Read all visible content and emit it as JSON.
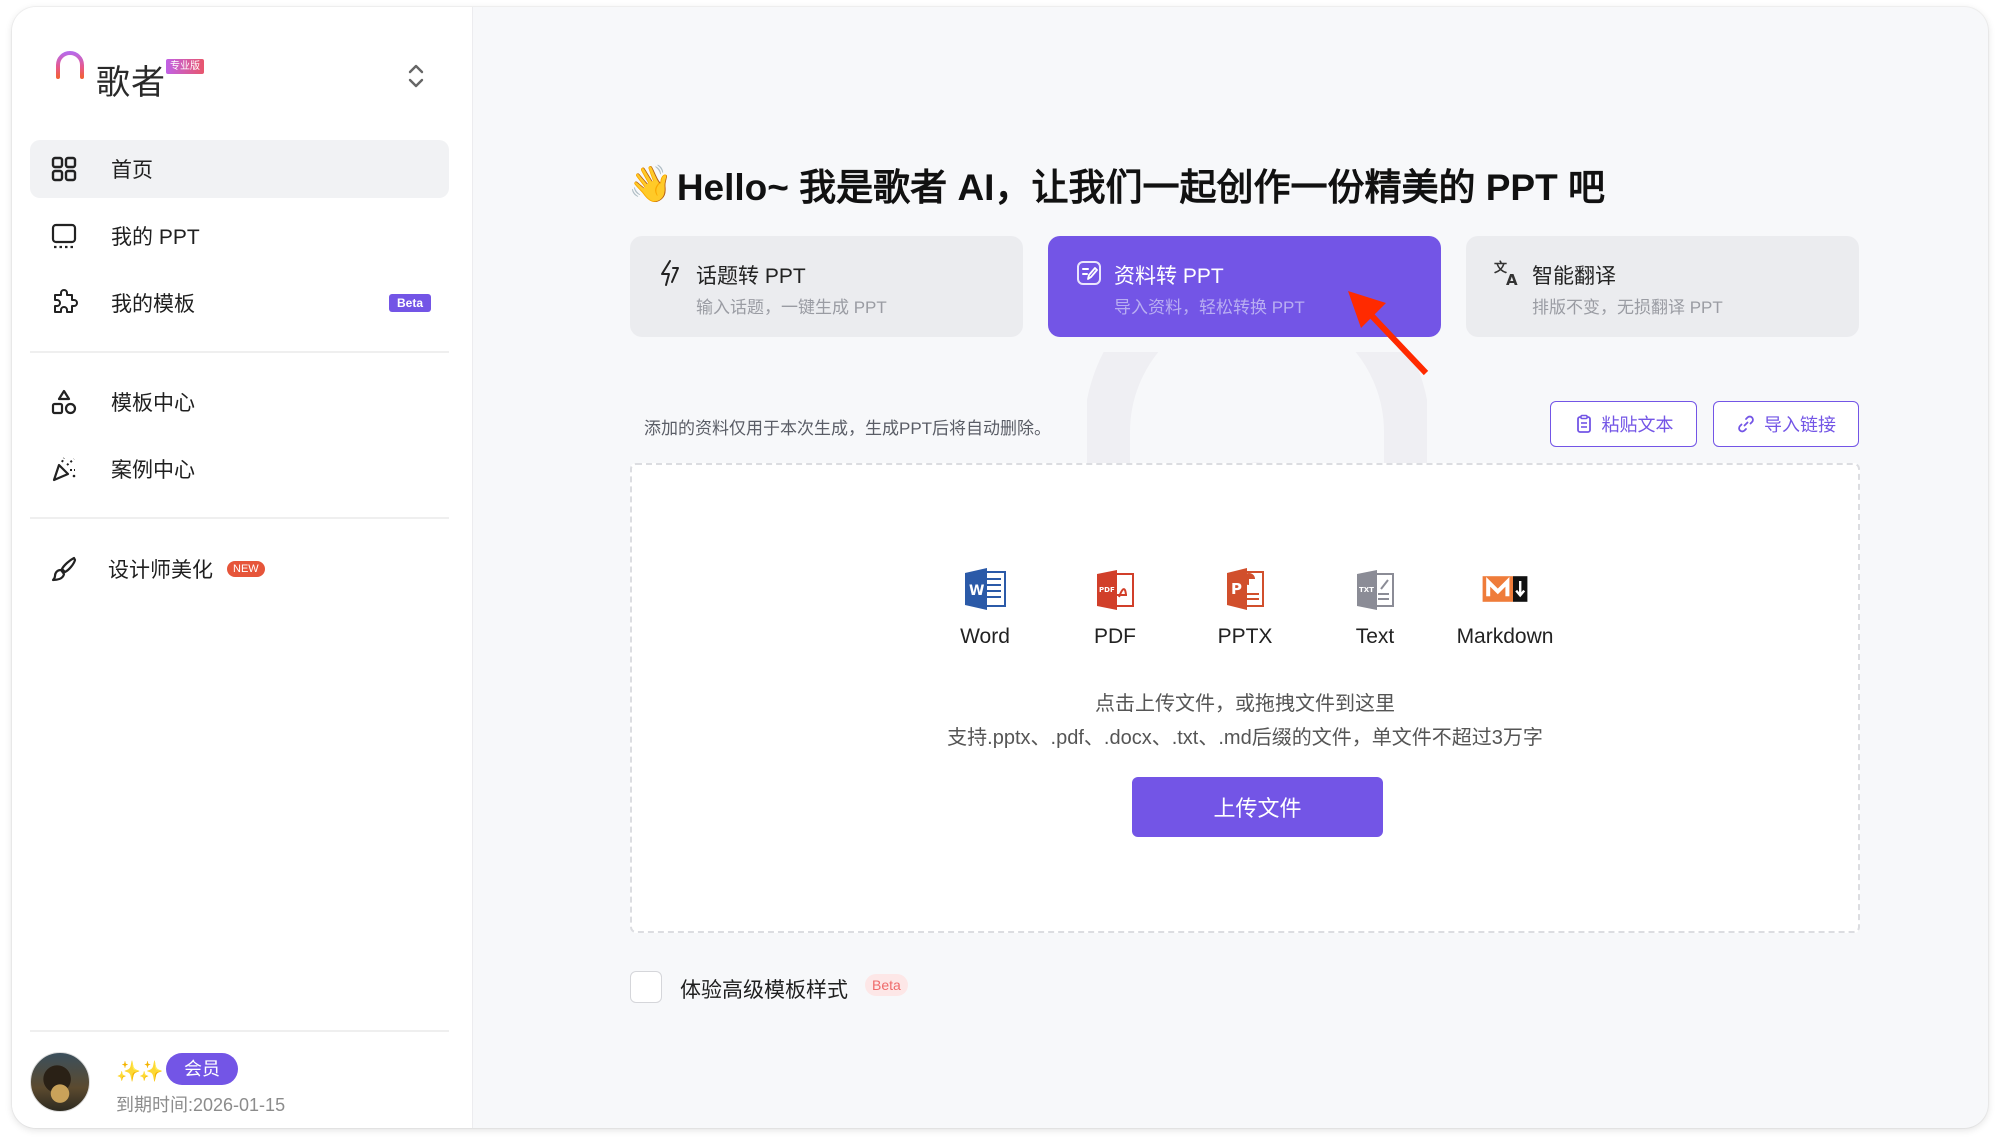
{
  "app": {
    "brand": "歌者",
    "edition_badge": "专业版"
  },
  "sidebar": {
    "items": [
      {
        "label": "首页",
        "icon": "grid-icon",
        "active": true
      },
      {
        "label": "我的 PPT",
        "icon": "presentation-icon"
      },
      {
        "label": "我的模板",
        "icon": "puzzle-icon",
        "badge": "Beta"
      },
      {
        "label": "模板中心",
        "icon": "shapes-icon"
      },
      {
        "label": "案例中心",
        "icon": "party-popper-icon"
      },
      {
        "label": "设计师美化",
        "icon": "brush-icon",
        "badge": "NEW"
      }
    ],
    "user": {
      "sparkles": "✨✨",
      "membership_badge": "会员",
      "expiry": "到期时间:2026-01-15"
    }
  },
  "main": {
    "wave_emoji": "👋",
    "title": "Hello~ 我是歌者 AI，让我们一起创作一份精美的 PPT 吧",
    "modes": [
      {
        "title": "话题转 PPT",
        "subtitle": "输入话题，一键生成 PPT",
        "icon": "lightning-icon",
        "active": false
      },
      {
        "title": "资料转 PPT",
        "subtitle": "导入资料，轻松转换 PPT",
        "icon": "document-edit-icon",
        "active": true
      },
      {
        "title": "智能翻译",
        "subtitle": "排版不变，无损翻译 PPT",
        "icon": "translate-icon",
        "active": false
      }
    ],
    "notice": "添加的资料仅用于本次生成，生成PPT后将自动删除。",
    "paste_text_label": "粘贴文本",
    "import_link_label": "导入链接",
    "dropzone": {
      "formats": [
        {
          "label": "Word",
          "icon": "word-file-icon"
        },
        {
          "label": "PDF",
          "icon": "pdf-file-icon"
        },
        {
          "label": "PPTX",
          "icon": "pptx-file-icon"
        },
        {
          "label": "Text",
          "icon": "text-file-icon"
        },
        {
          "label": "Markdown",
          "icon": "markdown-file-icon"
        }
      ],
      "hint_primary": "点击上传文件，或拖拽文件到这里",
      "hint_secondary": "支持.pptx、.pdf、.docx、.txt、.md后缀的文件，单文件不超过3万字",
      "upload_label": "上传文件"
    },
    "advanced_template": {
      "label": "体验高级模板样式",
      "badge": "Beta",
      "checked": false
    }
  },
  "colors": {
    "accent": "#7355e6",
    "card_bg": "#ebecef",
    "new_badge": "#e6553a",
    "annotation_arrow": "#ff2a00"
  }
}
